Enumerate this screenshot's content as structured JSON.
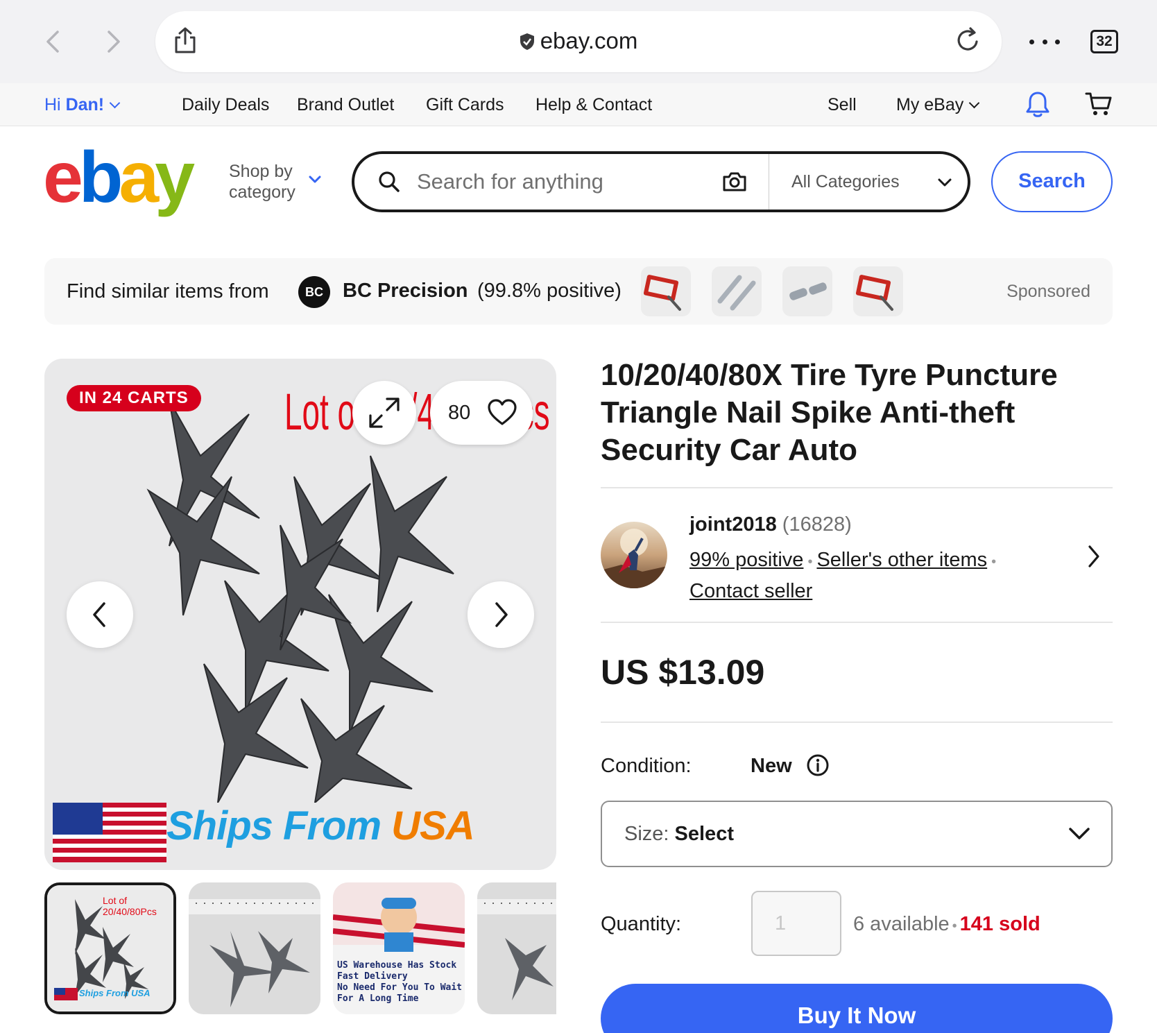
{
  "browser": {
    "domain": "ebay.com",
    "tab_count": "32"
  },
  "topnav": {
    "greeting_prefix": "Hi ",
    "greeting_name": "Dan!",
    "links": [
      "Daily Deals",
      "Brand Outlet",
      "Gift Cards",
      "Help & Contact"
    ],
    "sell": "Sell",
    "my_ebay": "My eBay"
  },
  "header": {
    "logo_letters": [
      "e",
      "b",
      "a",
      "y"
    ],
    "shop_by_line1": "Shop by",
    "shop_by_line2": "category",
    "search_placeholder": "Search for anything",
    "category_select": "All Categories",
    "search_button": "Search"
  },
  "similar": {
    "lead": "Find similar items from",
    "brand_logo": "BC",
    "brand": "BC Precision",
    "rating": "(99.8% positive)",
    "sponsored": "Sponsored"
  },
  "gallery": {
    "badge": "IN 24 CARTS",
    "image_text": "Lot of 20/40/80Pcs",
    "watch_count": "80",
    "banner_part1": "Ships From ",
    "banner_part2": "USA",
    "thumb1_text": "Lot of 20/40/80Pcs",
    "thumb1_banner": "Ships From USA",
    "thumb3_lines": [
      "US Warehouse Has Stock",
      "Fast Delivery",
      "No Need For You To Wait",
      "For A Long Time"
    ]
  },
  "listing": {
    "title": "10/20/40/80X Tire Tyre Puncture Triangle Nail Spike Anti-theft Security Car Auto",
    "seller_name": "joint2018",
    "seller_feedback": "(16828)",
    "positive": "99% positive",
    "other_items": "Seller's other items",
    "contact": "Contact seller",
    "price": "US $13.09",
    "condition_label": "Condition:",
    "condition_value": "New",
    "size_label": "Size: ",
    "size_value": "Select",
    "quantity_label": "Quantity:",
    "quantity_value": "1",
    "available": "6 available",
    "sold": "141 sold",
    "buy_button": "Buy It Now"
  },
  "colors": {
    "accent_blue": "#3665f3",
    "badge_red": "#d6001c",
    "logo_red": "#e53238",
    "logo_blue": "#0064d2",
    "logo_yellow": "#f5af02",
    "logo_green": "#86b817"
  }
}
